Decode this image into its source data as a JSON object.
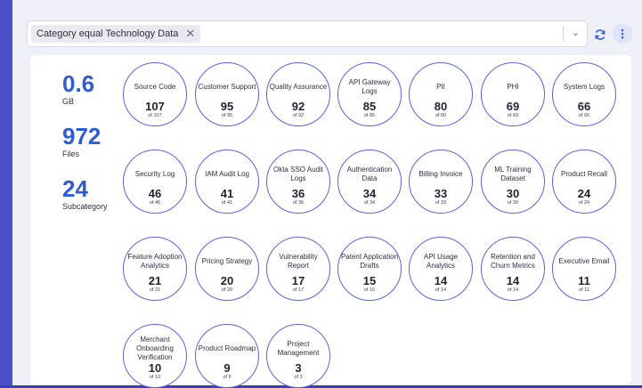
{
  "filter": {
    "chip_label": "Category equal Technology Data",
    "chip_close": "✕",
    "chevron": "⌄"
  },
  "stats": [
    {
      "value": "0.6",
      "label": "GB"
    },
    {
      "value": "972",
      "label": "Files"
    },
    {
      "value": "24",
      "label": "Subcategory"
    }
  ],
  "categories": [
    {
      "name": "Source Code",
      "count": "107",
      "of": "of 107"
    },
    {
      "name": "Customer Support",
      "count": "95",
      "of": "of 95"
    },
    {
      "name": "Quality Assurance",
      "count": "92",
      "of": "of 92"
    },
    {
      "name": "API Gateway Logs",
      "count": "85",
      "of": "of 85"
    },
    {
      "name": "PII",
      "count": "80",
      "of": "of 80"
    },
    {
      "name": "PHI",
      "count": "69",
      "of": "of 69"
    },
    {
      "name": "System Logs",
      "count": "66",
      "of": "of 66"
    },
    {
      "name": "Security Log",
      "count": "46",
      "of": "of 46"
    },
    {
      "name": "IAM Audit Log",
      "count": "41",
      "of": "of 41"
    },
    {
      "name": "Okta SSO Audit Logs",
      "count": "36",
      "of": "of 36"
    },
    {
      "name": "Authentication Data",
      "count": "34",
      "of": "of 34"
    },
    {
      "name": "Billing Invoice",
      "count": "33",
      "of": "of 33"
    },
    {
      "name": "ML Training Dataset",
      "count": "30",
      "of": "of 30"
    },
    {
      "name": "Product Recall",
      "count": "24",
      "of": "of 24"
    },
    {
      "name": "Feature Adoption Analytics",
      "count": "21",
      "of": "of 21"
    },
    {
      "name": "Pricing Strategy",
      "count": "20",
      "of": "of 20"
    },
    {
      "name": "Vulnerability Report",
      "count": "17",
      "of": "of 17"
    },
    {
      "name": "Patent Application Drafts",
      "count": "15",
      "of": "of 15"
    },
    {
      "name": "API Usage Analytics",
      "count": "14",
      "of": "of 14"
    },
    {
      "name": "Retention and Churn Metrics",
      "count": "14",
      "of": "of 14"
    },
    {
      "name": "Executive Email",
      "count": "11",
      "of": "of 11"
    },
    {
      "name": "Merchant Onboarding Verification",
      "count": "10",
      "of": "of 10"
    },
    {
      "name": "Product Roadmap",
      "count": "9",
      "of": "of 9"
    },
    {
      "name": "Project Management",
      "count": "3",
      "of": "of 3"
    }
  ],
  "colors": {
    "accent": "#2f5bd3",
    "circle_border": "#5b63d8",
    "background": "#3a3fb8"
  },
  "icons": {
    "refresh": "refresh-icon",
    "more": "more-vertical-icon"
  }
}
